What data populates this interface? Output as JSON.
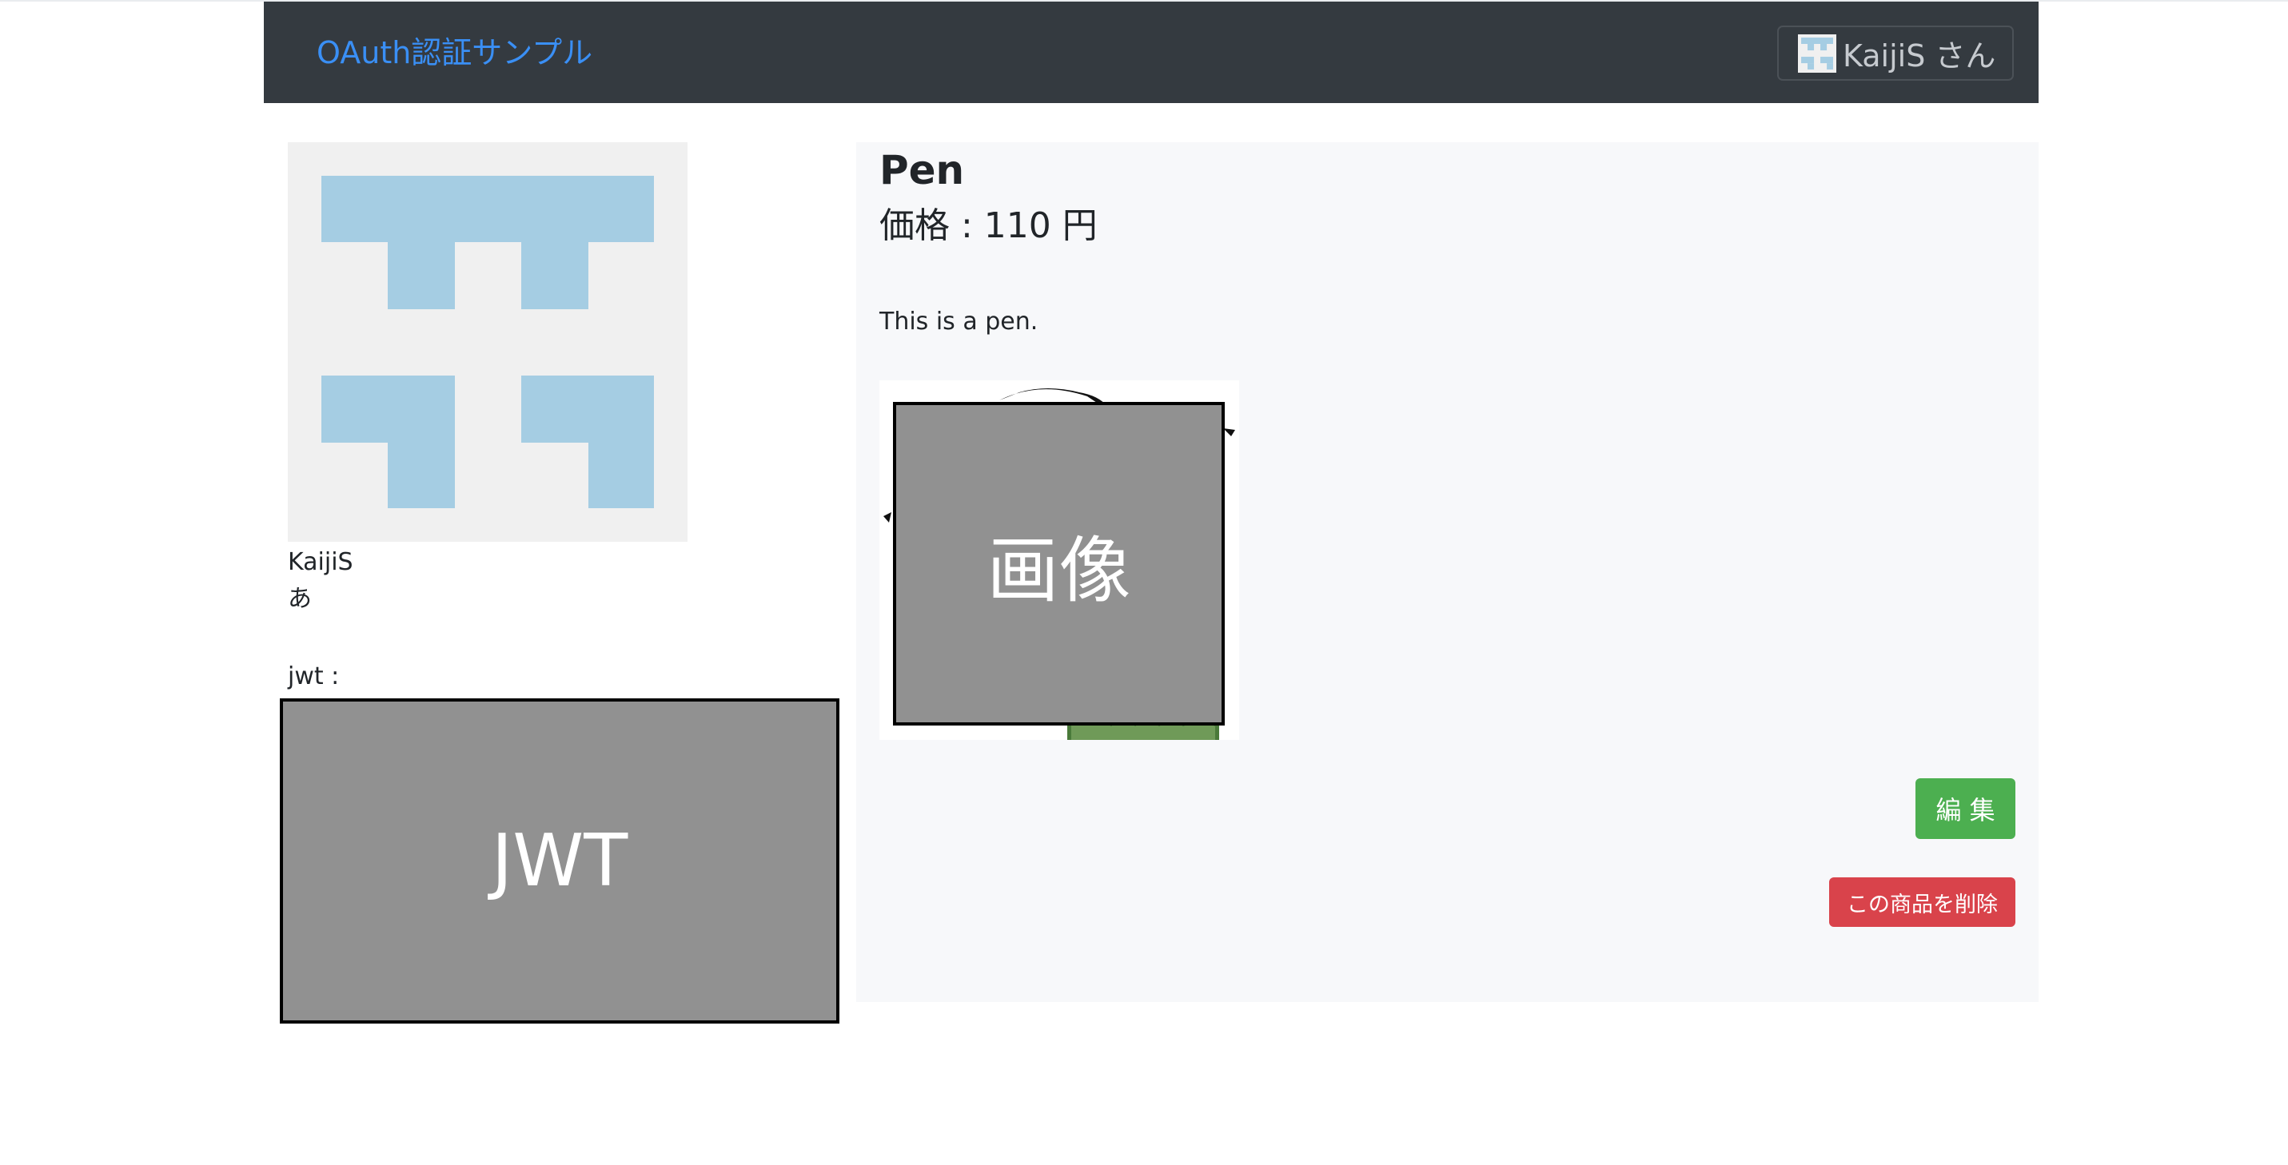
{
  "navbar": {
    "brand": "OAuth認証サンプル",
    "user_label": "KaijiS さん"
  },
  "profile": {
    "name": "KaijiS",
    "bio": "あ",
    "jwt_label": "jwt :",
    "jwt_placeholder": "JWT"
  },
  "product": {
    "title": "Pen",
    "price": "価格 : 110 円",
    "description": "This is a pen.",
    "image_placeholder": "画像",
    "edit_label": "編 集",
    "delete_label": "この商品を削除"
  },
  "colors": {
    "navbar_bg": "#343a40",
    "brand": "#3a8ff5",
    "edit_button": "#4caf50",
    "delete_button": "#d9434b",
    "identicon_fill": "#a5cde3",
    "identicon_bg": "#f0f0f0"
  },
  "icons": {
    "user_avatar": "identicon-avatar",
    "profile_avatar": "identicon-avatar"
  }
}
